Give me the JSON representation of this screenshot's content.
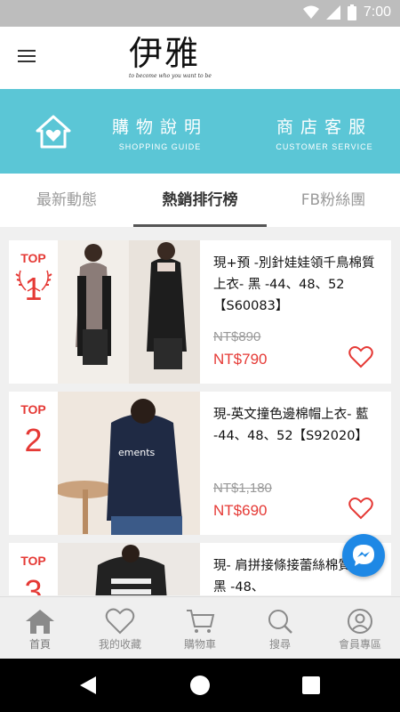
{
  "status": {
    "time": "7:00"
  },
  "header": {
    "logo_text": "伊雅",
    "logo_tagline": "to become who you want to be"
  },
  "banner": {
    "shopping_title": "購物說明",
    "shopping_sub": "SHOPPING GUIDE",
    "service_title": "商店客服",
    "service_sub": "CUSTOMER SERVICE"
  },
  "tabs": [
    {
      "label": "最新動態"
    },
    {
      "label": "熱銷排行榜",
      "active": true
    },
    {
      "label": "FB粉絲團"
    }
  ],
  "products": [
    {
      "rank_label": "TOP",
      "rank": "1",
      "name": "現+預 -別針娃娃領千鳥棉質上衣- 黑 -44、48、52【S60083】",
      "price_old": "NT$890",
      "price_new": "NT$790"
    },
    {
      "rank_label": "TOP",
      "rank": "2",
      "name": "現-英文撞色邊棉帽上衣- 藍 -44、48、52【S92020】",
      "price_old": "NT$1,180",
      "price_new": "NT$690"
    },
    {
      "rank_label": "TOP",
      "rank": "3",
      "name": "現- 肩拼接條接蕾絲棉質上衣- 黑 -48、",
      "price_old": "",
      "price_new": ""
    }
  ],
  "bottom_nav": [
    {
      "label": "首頁",
      "icon": "home-icon"
    },
    {
      "label": "我的收藏",
      "icon": "heart-icon"
    },
    {
      "label": "購物車",
      "icon": "cart-icon"
    },
    {
      "label": "搜尋",
      "icon": "search-icon"
    },
    {
      "label": "會員專區",
      "icon": "user-icon"
    }
  ],
  "colors": {
    "banner": "#5bc6d6",
    "accent": "#e53935",
    "messenger": "#1e88e5"
  }
}
